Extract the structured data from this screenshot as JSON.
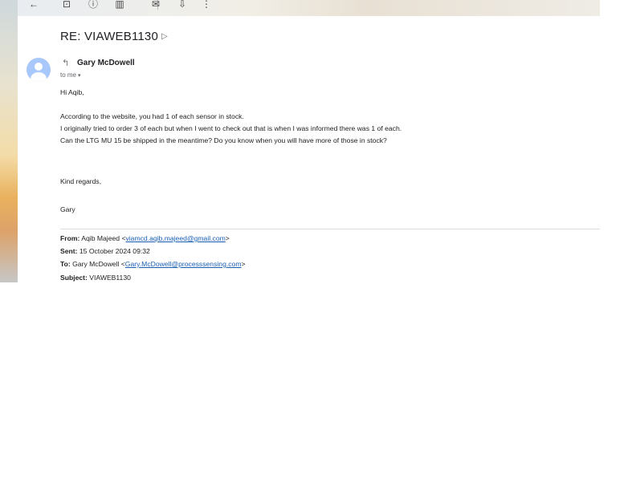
{
  "toolbar": {
    "icons": [
      "back-arrow-icon",
      "archive-icon",
      "report-spam-icon",
      "delete-icon",
      "mark-unread-icon",
      "move-to-icon",
      "more-options-icon"
    ],
    "glyphs": [
      "←",
      "⊡",
      "ⓘ",
      "▥",
      "✉",
      "⇩",
      "⋮"
    ]
  },
  "email": {
    "subject": "RE: VIAWEB1130",
    "label_glyph": "▷",
    "sender": "Gary McDowell",
    "to_me": "to me",
    "caret": "▾",
    "body": [
      "Hi Aqib,",
      "According to the website, you had 1 of each sensor in stock.",
      "I originally tried to order 3 of each but when I went to check out that is when I was informed there was 1 of each.",
      "Can the LTG MU 15 be shipped in the meantime? Do you know when you will have more of those in stock?",
      "Kind regards,",
      "Gary"
    ],
    "quoted": {
      "from_label": "From:",
      "from_name": "Aqib Majeed <",
      "from_email": "viamcd.aqib.majeed@gmail.com",
      "from_end": ">",
      "sent_label": "Sent:",
      "sent_value": "15 October 2024 09:32",
      "to_label": "To:",
      "to_name": "Gary McDowell <",
      "to_email": "Gary.McDowell@processsensing.com",
      "to_end": ">",
      "subject_label": "Subject:",
      "subject_value": "VIAWEB1130"
    }
  }
}
